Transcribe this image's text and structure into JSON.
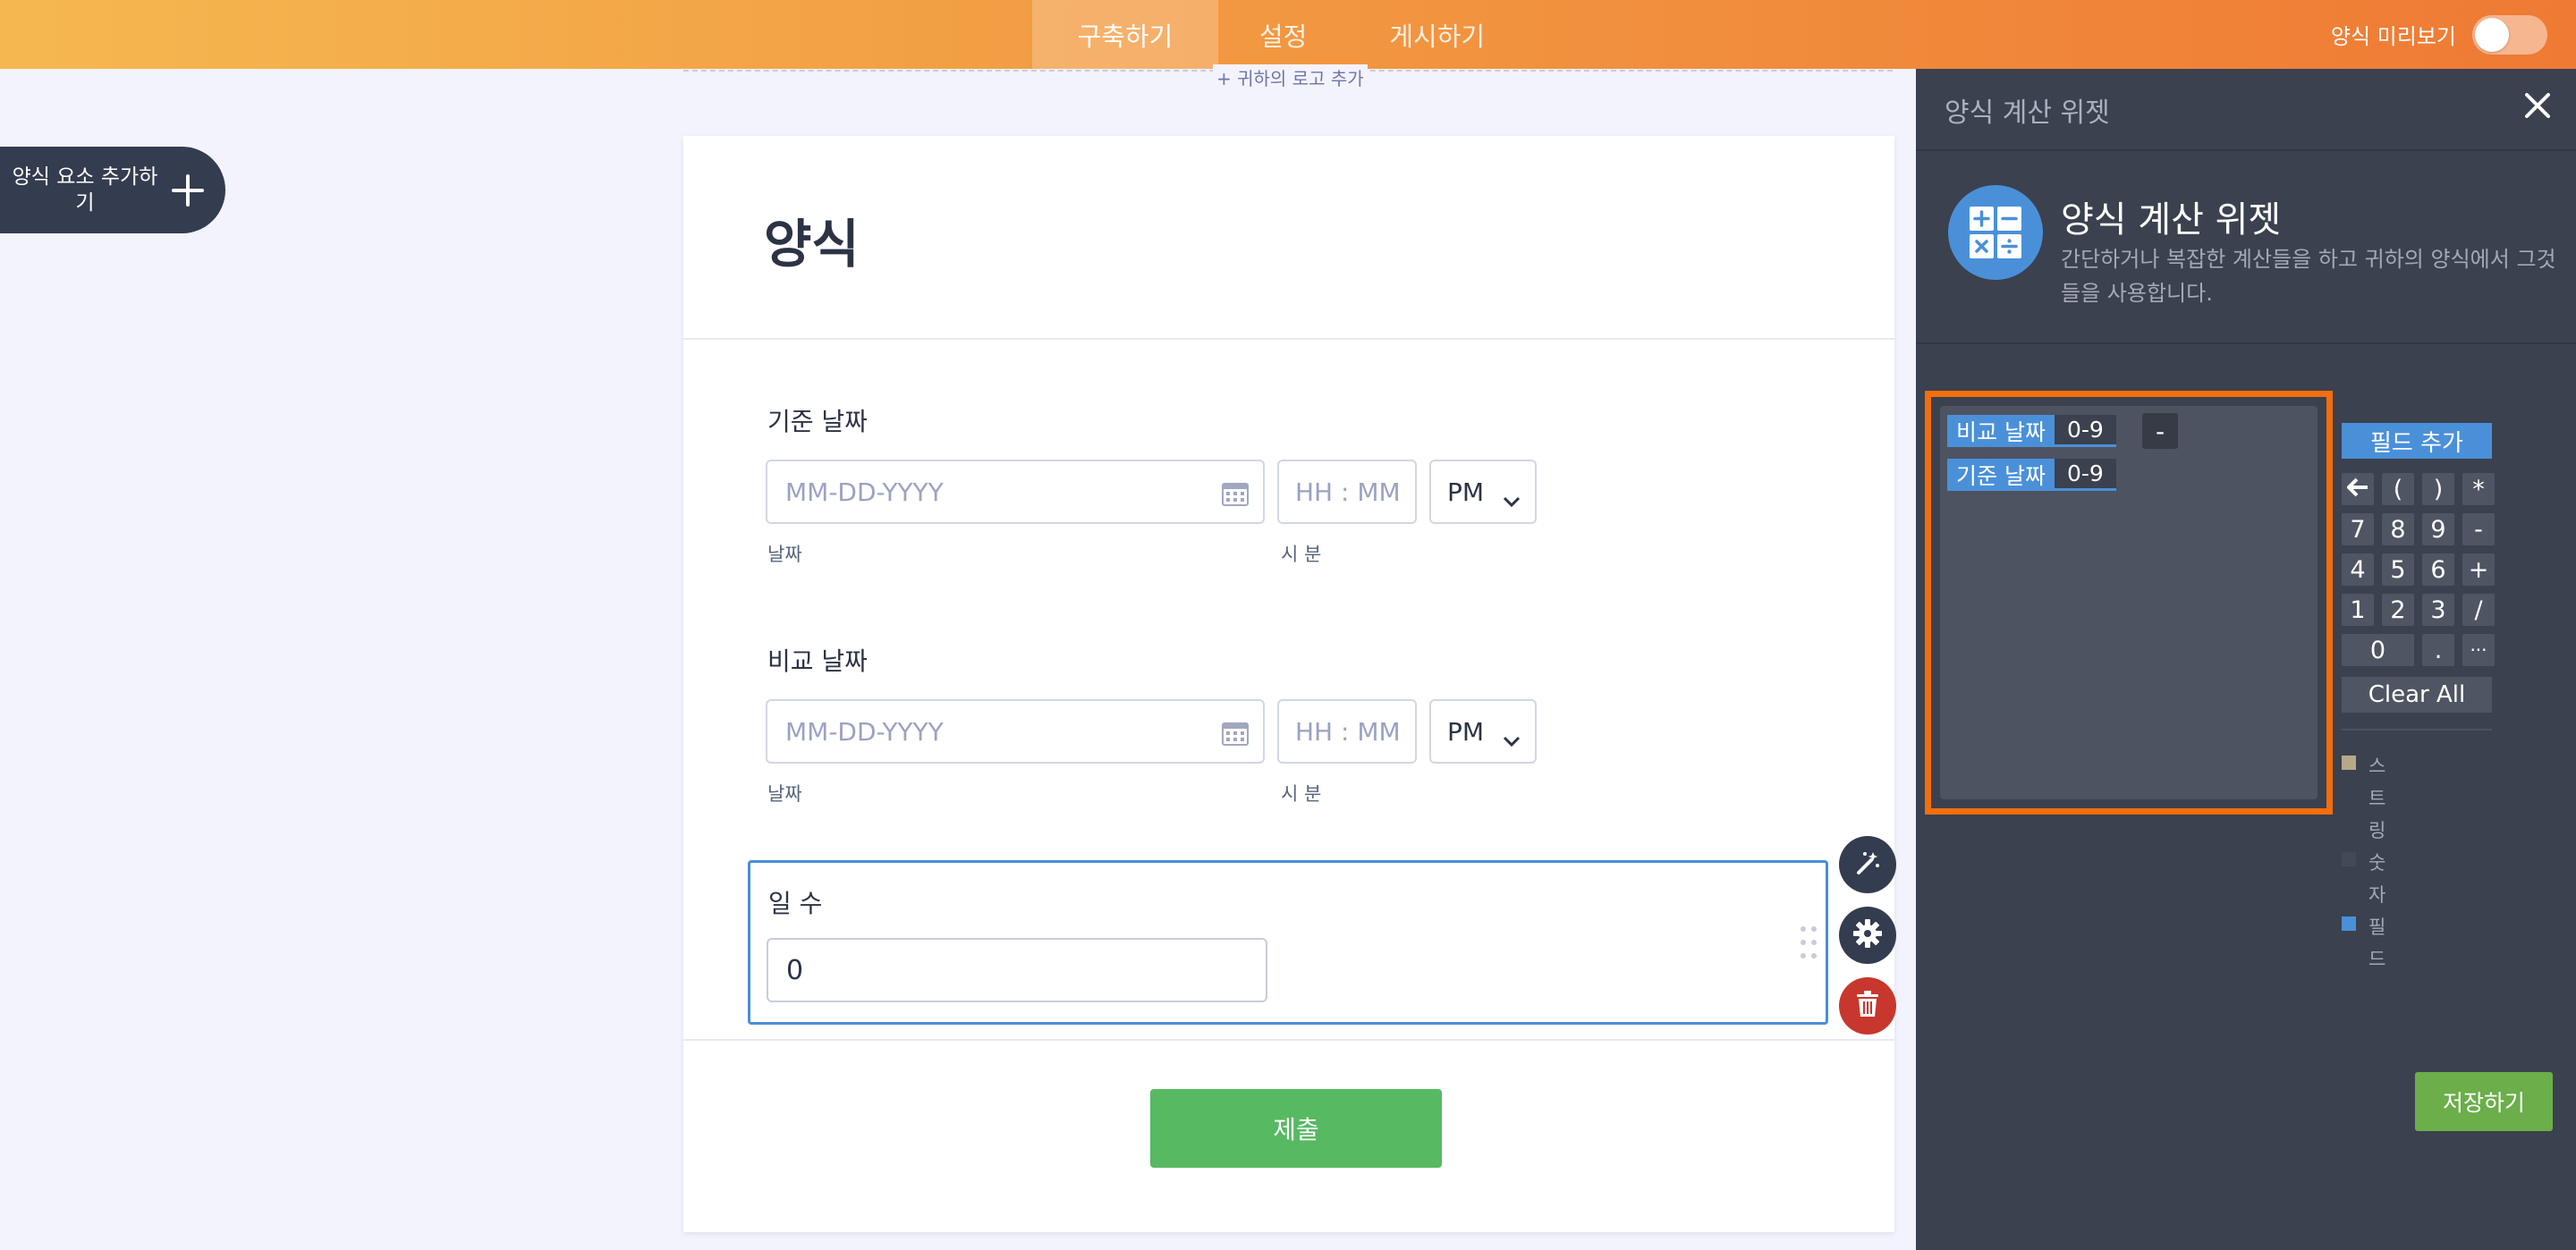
{
  "nav": {
    "tabs": [
      "구축하기",
      "설정",
      "게시하기"
    ],
    "active_tab": 0,
    "preview_label": "양식 미리보기",
    "preview_on": false
  },
  "sidebar": {
    "add_element_label": "양식 요소 추가하기"
  },
  "canvas": {
    "logo_hint": "+ 귀하의 로고 추가",
    "form_title": "양식",
    "fields": [
      {
        "label": "기준 날짜",
        "date_placeholder": "MM-DD-YYYY",
        "time_placeholder": "HH : MM",
        "ampm": "PM",
        "date_sublabel": "날짜",
        "time_sublabel": "시 분"
      },
      {
        "label": "비교 날짜",
        "date_placeholder": "MM-DD-YYYY",
        "time_placeholder": "HH : MM",
        "ampm": "PM",
        "date_sublabel": "날짜",
        "time_sublabel": "시 분"
      }
    ],
    "days_field": {
      "label": "일 수",
      "value": "0"
    },
    "submit_label": "제출"
  },
  "panel": {
    "header_title": "양식 계산 위젯",
    "widget_name": "양식 계산 위젯",
    "widget_description": "간단하거나 복잡한 계산들을 하고 귀하의 양식에서 그것들을 사용합니다.",
    "formula": {
      "tokens": [
        {
          "name": "비교 날짜",
          "type": "0-9"
        },
        {
          "operator": "-"
        },
        {
          "name": "기준 날짜",
          "type": "0-9"
        }
      ]
    },
    "add_field_label": "필드 추가",
    "keypad": [
      "🡐",
      "(",
      ")",
      "*",
      "7",
      "8",
      "9",
      "-",
      "4",
      "5",
      "6",
      "+",
      "1",
      "2",
      "3",
      "/",
      "0",
      ".",
      "···"
    ],
    "clear_all_label": "Clear All",
    "legend": [
      {
        "label": "스트링",
        "color": "#b8a88a"
      },
      {
        "label": "숫자",
        "color": "#444a55"
      },
      {
        "label": "필드",
        "color": "#4a90d9"
      }
    ],
    "save_label": "저장하기"
  },
  "colors": {
    "accent_orange": "#f46e0c",
    "field_blue": "#4a90d9",
    "submit_green": "#57b962",
    "save_green": "#6bae4a",
    "delete_red": "#c8372d"
  }
}
